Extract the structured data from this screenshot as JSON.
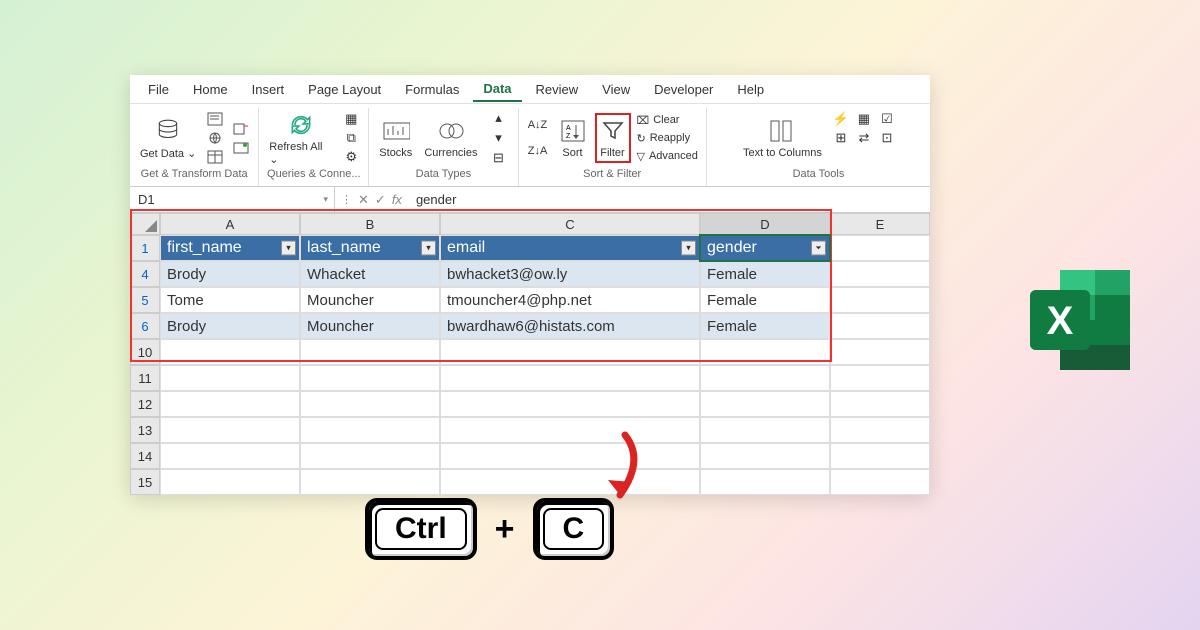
{
  "tabs": [
    "File",
    "Home",
    "Insert",
    "Page Layout",
    "Formulas",
    "Data",
    "Review",
    "View",
    "Developer",
    "Help"
  ],
  "activeTab": "Data",
  "ribbon": {
    "getData": {
      "label": "Get Data ⌄",
      "group": "Get & Transform Data"
    },
    "refresh": {
      "label": "Refresh All ⌄",
      "group": "Queries & Conne..."
    },
    "dataTypes": {
      "stocks": "Stocks",
      "currencies": "Currencies",
      "group": "Data Types"
    },
    "sortFilter": {
      "sort": "Sort",
      "filter": "Filter",
      "clear": "Clear",
      "reapply": "Reapply",
      "advanced": "Advanced",
      "group": "Sort & Filter"
    },
    "dataTools": {
      "textToCols": "Text to Columns",
      "group": "Data Tools"
    }
  },
  "nameBox": "D1",
  "formulaValue": "gender",
  "columns": [
    "A",
    "B",
    "C",
    "D",
    "E"
  ],
  "headers": {
    "A": "first_name",
    "B": "last_name",
    "C": "email",
    "D": "gender"
  },
  "selectedCell": "D1",
  "visibleRows": [
    1,
    4,
    5,
    6,
    10,
    11,
    12,
    13,
    14,
    15
  ],
  "rows": {
    "4": {
      "A": "Brody",
      "B": "Whacket",
      "C": "bwhacket3@ow.ly",
      "D": "Female"
    },
    "5": {
      "A": "Tome",
      "B": "Mouncher",
      "C": "tmouncher4@php.net",
      "D": "Female"
    },
    "6": {
      "A": "Brody",
      "B": "Mouncher",
      "C": "bwardhaw6@histats.com",
      "D": "Female"
    }
  },
  "keys": {
    "k1": "Ctrl",
    "plus": "+",
    "k2": "C"
  },
  "chart_data": {
    "type": "table",
    "columns": [
      "first_name",
      "last_name",
      "email",
      "gender"
    ],
    "records": [
      {
        "row": 4,
        "first_name": "Brody",
        "last_name": "Whacket",
        "email": "bwhacket3@ow.ly",
        "gender": "Female"
      },
      {
        "row": 5,
        "first_name": "Tome",
        "last_name": "Mouncher",
        "email": "tmouncher4@php.net",
        "gender": "Female"
      },
      {
        "row": 6,
        "first_name": "Brody",
        "last_name": "Mouncher",
        "email": "bwardhaw6@histats.com",
        "gender": "Female"
      }
    ],
    "filtered_column": "gender",
    "title": "",
    "annotations": [
      "Ctrl + C"
    ]
  }
}
